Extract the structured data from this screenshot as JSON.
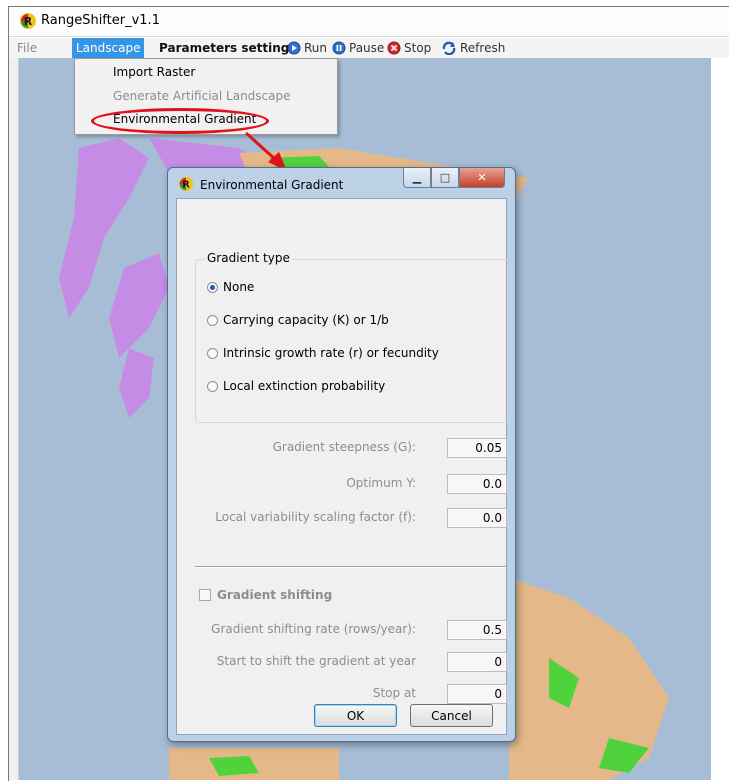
{
  "window": {
    "title": "RangeShifter_v1.1"
  },
  "menubar": {
    "file": "File",
    "landscape": "Landscape",
    "parameters": "Parameters setting",
    "run": "Run",
    "pause": "Pause",
    "stop": "Stop",
    "refresh": "Refresh"
  },
  "dropdown": {
    "items": [
      "Import Raster",
      "Generate Artificial Landscape",
      "Environmental Gradient"
    ]
  },
  "dialog": {
    "title": "Environmental Gradient",
    "gradient_type_label": "Gradient type",
    "options": [
      "None",
      "Carrying capacity (K) or 1/b",
      "Intrinsic growth rate (r) or fecundity",
      "Local extinction probability"
    ],
    "selected_option": "None",
    "fields": [
      {
        "label": "Gradient steepness (G):",
        "value": "0.05"
      },
      {
        "label": "Optimum Y:",
        "value": "0.0"
      },
      {
        "label": "Local variability scaling factor (f):",
        "value": "0.0"
      }
    ],
    "shifting": {
      "label": "Gradient shifting",
      "checked": false,
      "fields": [
        {
          "label": "Gradient shifting rate (rows/year):",
          "value": "0.5"
        },
        {
          "label": "Start to shift the gradient at year",
          "value": "0"
        },
        {
          "label": "Stop at",
          "value": "0"
        }
      ]
    },
    "ok": "OK",
    "cancel": "Cancel"
  },
  "colors": {
    "menu_highlight": "#3596e6",
    "annotation": "#e0131c",
    "map_sea": "#a7bdd6",
    "land": "#e4b889",
    "vegetation": "#4fd23c",
    "heath": "#c58ce6"
  }
}
